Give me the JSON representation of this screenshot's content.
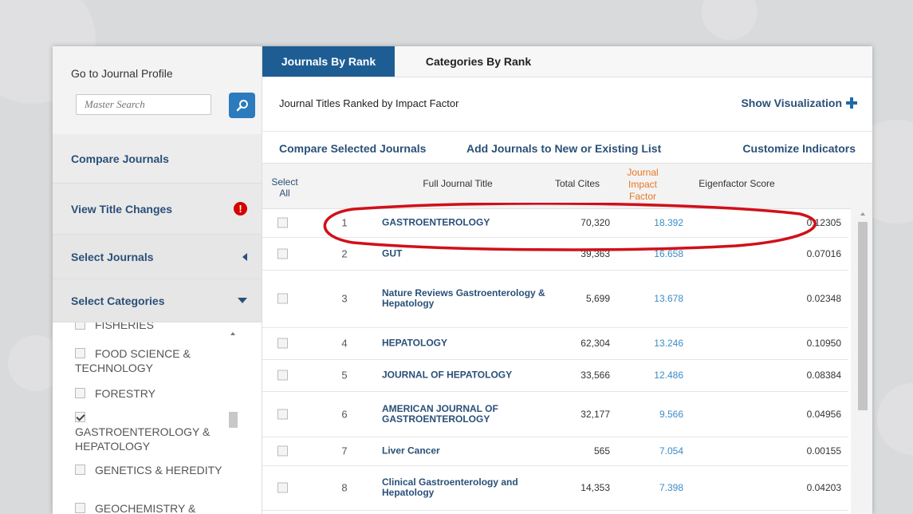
{
  "colors": {
    "accent": "#1e5d94",
    "link": "#2a5078",
    "impact_factor": "#3a8cc8",
    "impact_header": "#e87722",
    "warning": "#d40000",
    "annotation": "#d0101a"
  },
  "sidebar": {
    "profile_title": "Go to Journal Profile",
    "search_placeholder": "Master Search",
    "search_icon": "search-icon",
    "items": [
      {
        "label": "Compare Journals"
      },
      {
        "label": "View Title Changes",
        "icon": "exclamation-icon",
        "icon_glyph": "!"
      },
      {
        "label": "Select Journals",
        "icon": "caret-left-icon"
      },
      {
        "label": "Select Categories",
        "icon": "caret-down-icon"
      }
    ],
    "categories": [
      {
        "label": "FISHERIES",
        "checked": false
      },
      {
        "label": "FOOD SCIENCE & TECHNOLOGY",
        "checked": false
      },
      {
        "label": "FORESTRY",
        "checked": false
      },
      {
        "label": "GASTROENTEROLOGY & HEPATOLOGY",
        "checked": true
      },
      {
        "label": "GENETICS & HEREDITY",
        "checked": false
      },
      {
        "label": "GEOCHEMISTRY &",
        "checked": false
      }
    ]
  },
  "main": {
    "tabs": [
      {
        "label": "Journals By Rank",
        "active": true
      },
      {
        "label": "Categories By Rank",
        "active": false
      }
    ],
    "ranked_title": "Journal Titles Ranked by Impact Factor",
    "show_visualization": "Show Visualization",
    "actions": {
      "compare": "Compare Selected Journals",
      "add": "Add Journals to New or Existing List",
      "customize": "Customize Indicators"
    },
    "table": {
      "headers": {
        "select_all": "Select All",
        "title": "Full Journal Title",
        "cites": "Total Cites",
        "impact": "Journal Impact Factor",
        "eigen": "Eigenfactor Score"
      },
      "rows": [
        {
          "rank": "1",
          "title": "GASTROENTEROLOGY",
          "cites": "70,320",
          "jif": "18.392",
          "eig": "0.12305"
        },
        {
          "rank": "2",
          "title": "GUT",
          "cites": "39,363",
          "jif": "16.658",
          "eig": "0.07016"
        },
        {
          "rank": "3",
          "title": "Nature Reviews Gastroenterology & Hepatology",
          "cites": "5,699",
          "jif": "13.678",
          "eig": "0.02348"
        },
        {
          "rank": "4",
          "title": "HEPATOLOGY",
          "cites": "62,304",
          "jif": "13.246",
          "eig": "0.10950"
        },
        {
          "rank": "5",
          "title": "JOURNAL OF HEPATOLOGY",
          "cites": "33,566",
          "jif": "12.486",
          "eig": "0.08384"
        },
        {
          "rank": "6",
          "title": "AMERICAN JOURNAL OF GASTROENTEROLOGY",
          "cites": "32,177",
          "jif": "9.566",
          "eig": "0.04956"
        },
        {
          "rank": "7",
          "title": "Liver Cancer",
          "cites": "565",
          "jif": "7.054",
          "eig": "0.00155"
        },
        {
          "rank": "8",
          "title": "Clinical Gastroenterology and Hepatology",
          "cites": "14,353",
          "jif": "7.398",
          "eig": "0.04203"
        }
      ]
    }
  }
}
